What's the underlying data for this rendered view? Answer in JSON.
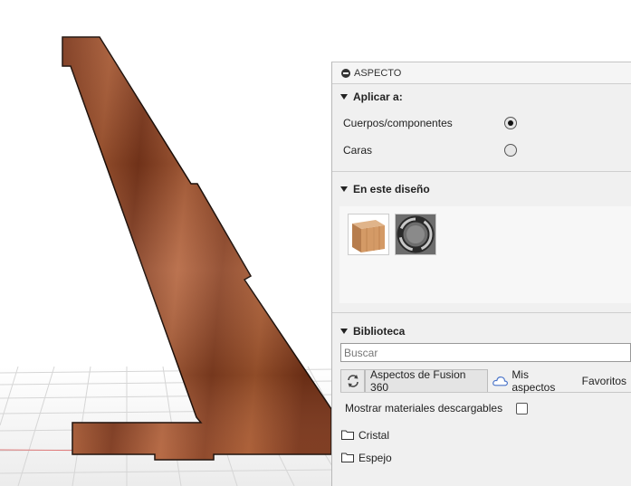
{
  "panel": {
    "title": "ASPECTO",
    "apply_section": {
      "title": "Aplicar a:",
      "options": [
        {
          "label": "Cuerpos/componentes",
          "selected": true
        },
        {
          "label": "Caras",
          "selected": false
        }
      ]
    },
    "design_section": {
      "title": "En este diseño",
      "materials": [
        {
          "icon": "wood-cube-icon"
        },
        {
          "icon": "metal-ring-icon"
        }
      ]
    },
    "library_section": {
      "title": "Biblioteca",
      "search_placeholder": "Buscar",
      "tabs": [
        {
          "label": "Aspectos de Fusion 360",
          "active": true
        },
        {
          "label": "Mis aspectos",
          "active": false
        },
        {
          "label": "Favoritos",
          "active": false
        }
      ],
      "show_downloadable_label": "Mostrar materiales descargables",
      "show_downloadable_checked": false,
      "folders": [
        "Cristal",
        "Espejo"
      ]
    }
  },
  "colors": {
    "wood_dark": "#6b2e16",
    "wood_mid": "#9a4e2c",
    "wood_light": "#b8643c",
    "panel_bg": "#f0f0f0",
    "cloud_blue": "#4a74c9"
  }
}
